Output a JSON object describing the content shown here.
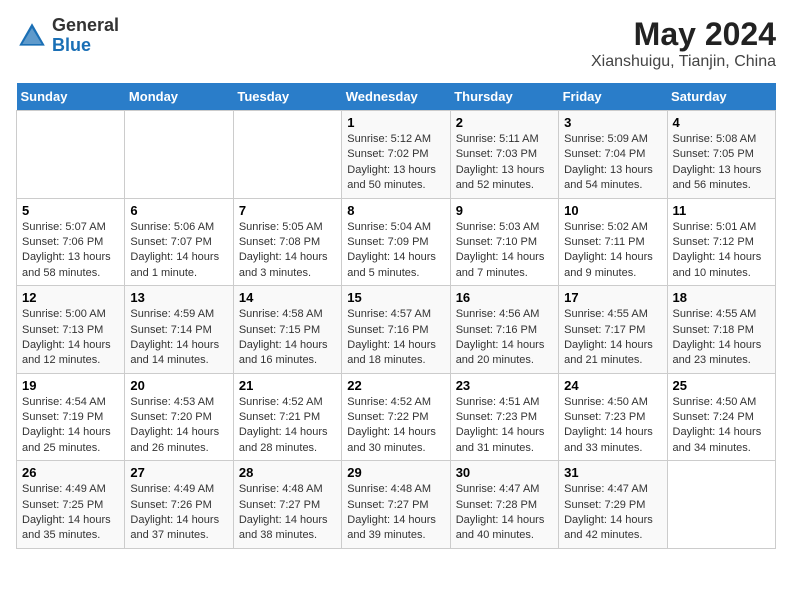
{
  "header": {
    "logo": {
      "general": "General",
      "blue": "Blue"
    },
    "title": "May 2024",
    "subtitle": "Xianshuigu, Tianjin, China"
  },
  "days_of_week": [
    "Sunday",
    "Monday",
    "Tuesday",
    "Wednesday",
    "Thursday",
    "Friday",
    "Saturday"
  ],
  "weeks": [
    [
      {
        "day": "",
        "info": ""
      },
      {
        "day": "",
        "info": ""
      },
      {
        "day": "",
        "info": ""
      },
      {
        "day": "1",
        "info": "Sunrise: 5:12 AM\nSunset: 7:02 PM\nDaylight: 13 hours and 50 minutes."
      },
      {
        "day": "2",
        "info": "Sunrise: 5:11 AM\nSunset: 7:03 PM\nDaylight: 13 hours and 52 minutes."
      },
      {
        "day": "3",
        "info": "Sunrise: 5:09 AM\nSunset: 7:04 PM\nDaylight: 13 hours and 54 minutes."
      },
      {
        "day": "4",
        "info": "Sunrise: 5:08 AM\nSunset: 7:05 PM\nDaylight: 13 hours and 56 minutes."
      }
    ],
    [
      {
        "day": "5",
        "info": "Sunrise: 5:07 AM\nSunset: 7:06 PM\nDaylight: 13 hours and 58 minutes."
      },
      {
        "day": "6",
        "info": "Sunrise: 5:06 AM\nSunset: 7:07 PM\nDaylight: 14 hours and 1 minute."
      },
      {
        "day": "7",
        "info": "Sunrise: 5:05 AM\nSunset: 7:08 PM\nDaylight: 14 hours and 3 minutes."
      },
      {
        "day": "8",
        "info": "Sunrise: 5:04 AM\nSunset: 7:09 PM\nDaylight: 14 hours and 5 minutes."
      },
      {
        "day": "9",
        "info": "Sunrise: 5:03 AM\nSunset: 7:10 PM\nDaylight: 14 hours and 7 minutes."
      },
      {
        "day": "10",
        "info": "Sunrise: 5:02 AM\nSunset: 7:11 PM\nDaylight: 14 hours and 9 minutes."
      },
      {
        "day": "11",
        "info": "Sunrise: 5:01 AM\nSunset: 7:12 PM\nDaylight: 14 hours and 10 minutes."
      }
    ],
    [
      {
        "day": "12",
        "info": "Sunrise: 5:00 AM\nSunset: 7:13 PM\nDaylight: 14 hours and 12 minutes."
      },
      {
        "day": "13",
        "info": "Sunrise: 4:59 AM\nSunset: 7:14 PM\nDaylight: 14 hours and 14 minutes."
      },
      {
        "day": "14",
        "info": "Sunrise: 4:58 AM\nSunset: 7:15 PM\nDaylight: 14 hours and 16 minutes."
      },
      {
        "day": "15",
        "info": "Sunrise: 4:57 AM\nSunset: 7:16 PM\nDaylight: 14 hours and 18 minutes."
      },
      {
        "day": "16",
        "info": "Sunrise: 4:56 AM\nSunset: 7:16 PM\nDaylight: 14 hours and 20 minutes."
      },
      {
        "day": "17",
        "info": "Sunrise: 4:55 AM\nSunset: 7:17 PM\nDaylight: 14 hours and 21 minutes."
      },
      {
        "day": "18",
        "info": "Sunrise: 4:55 AM\nSunset: 7:18 PM\nDaylight: 14 hours and 23 minutes."
      }
    ],
    [
      {
        "day": "19",
        "info": "Sunrise: 4:54 AM\nSunset: 7:19 PM\nDaylight: 14 hours and 25 minutes."
      },
      {
        "day": "20",
        "info": "Sunrise: 4:53 AM\nSunset: 7:20 PM\nDaylight: 14 hours and 26 minutes."
      },
      {
        "day": "21",
        "info": "Sunrise: 4:52 AM\nSunset: 7:21 PM\nDaylight: 14 hours and 28 minutes."
      },
      {
        "day": "22",
        "info": "Sunrise: 4:52 AM\nSunset: 7:22 PM\nDaylight: 14 hours and 30 minutes."
      },
      {
        "day": "23",
        "info": "Sunrise: 4:51 AM\nSunset: 7:23 PM\nDaylight: 14 hours and 31 minutes."
      },
      {
        "day": "24",
        "info": "Sunrise: 4:50 AM\nSunset: 7:23 PM\nDaylight: 14 hours and 33 minutes."
      },
      {
        "day": "25",
        "info": "Sunrise: 4:50 AM\nSunset: 7:24 PM\nDaylight: 14 hours and 34 minutes."
      }
    ],
    [
      {
        "day": "26",
        "info": "Sunrise: 4:49 AM\nSunset: 7:25 PM\nDaylight: 14 hours and 35 minutes."
      },
      {
        "day": "27",
        "info": "Sunrise: 4:49 AM\nSunset: 7:26 PM\nDaylight: 14 hours and 37 minutes."
      },
      {
        "day": "28",
        "info": "Sunrise: 4:48 AM\nSunset: 7:27 PM\nDaylight: 14 hours and 38 minutes."
      },
      {
        "day": "29",
        "info": "Sunrise: 4:48 AM\nSunset: 7:27 PM\nDaylight: 14 hours and 39 minutes."
      },
      {
        "day": "30",
        "info": "Sunrise: 4:47 AM\nSunset: 7:28 PM\nDaylight: 14 hours and 40 minutes."
      },
      {
        "day": "31",
        "info": "Sunrise: 4:47 AM\nSunset: 7:29 PM\nDaylight: 14 hours and 42 minutes."
      },
      {
        "day": "",
        "info": ""
      }
    ]
  ]
}
